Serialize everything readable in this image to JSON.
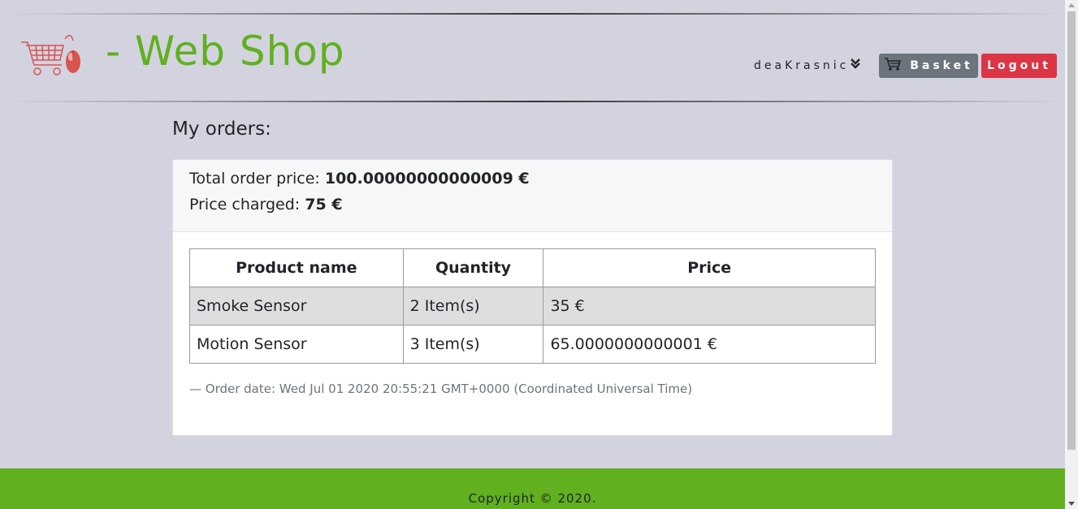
{
  "header": {
    "brand": "- Web Shop",
    "username": "deaKrasnic",
    "basket_label": "Basket",
    "logout_label": "Logout"
  },
  "main": {
    "title": "My orders:",
    "order": {
      "total_label": "Total order price:",
      "total_value": "100.00000000000009 €",
      "charged_label": "Price charged:",
      "charged_value": "75 €",
      "table": {
        "headers": [
          "Product name",
          "Quantity",
          "Price"
        ],
        "rows": [
          [
            "Smoke Sensor",
            "2 Item(s)",
            "35 €"
          ],
          [
            "Motion Sensor",
            "3 Item(s)",
            "65.0000000000001 €"
          ]
        ]
      },
      "order_date": "— Order date: Wed Jul 01 2020 20:55:21 GMT+0000 (Coordinated Universal Time)"
    }
  },
  "footer": {
    "copyright": "Copyright © 2020."
  },
  "colors": {
    "brand_green": "#60b01f",
    "background": "#d3d3e0",
    "basket_button": "#6c757d",
    "logout_button": "#dc3545"
  },
  "icons": {
    "logo": "shopping-cart-with-mouse-logo",
    "dropdown": "double-chevron-down-icon",
    "basket": "cart-icon"
  }
}
